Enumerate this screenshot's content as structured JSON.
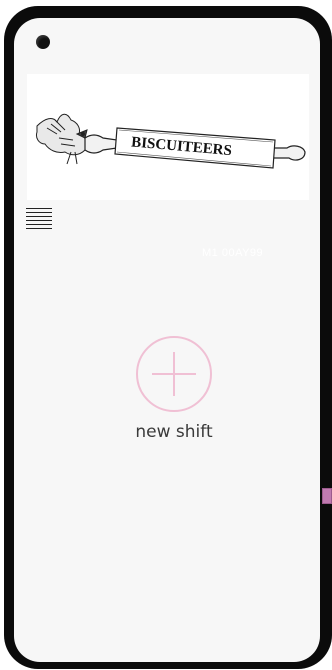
{
  "app": {
    "brand_name": "BISCUITEERS"
  },
  "header": {
    "user_id": "M1 00AY99"
  },
  "main": {
    "new_shift_label": "new shift"
  },
  "icons": {
    "menu": "hamburger-menu-icon",
    "add": "plus-circle-icon",
    "logo": "biscuiteers-logo"
  },
  "colors": {
    "accent": "#f0c0d4",
    "side_tab": "#c07ab0",
    "screen_bg": "#f7f7f7",
    "device_frame": "#0b0b0b"
  }
}
